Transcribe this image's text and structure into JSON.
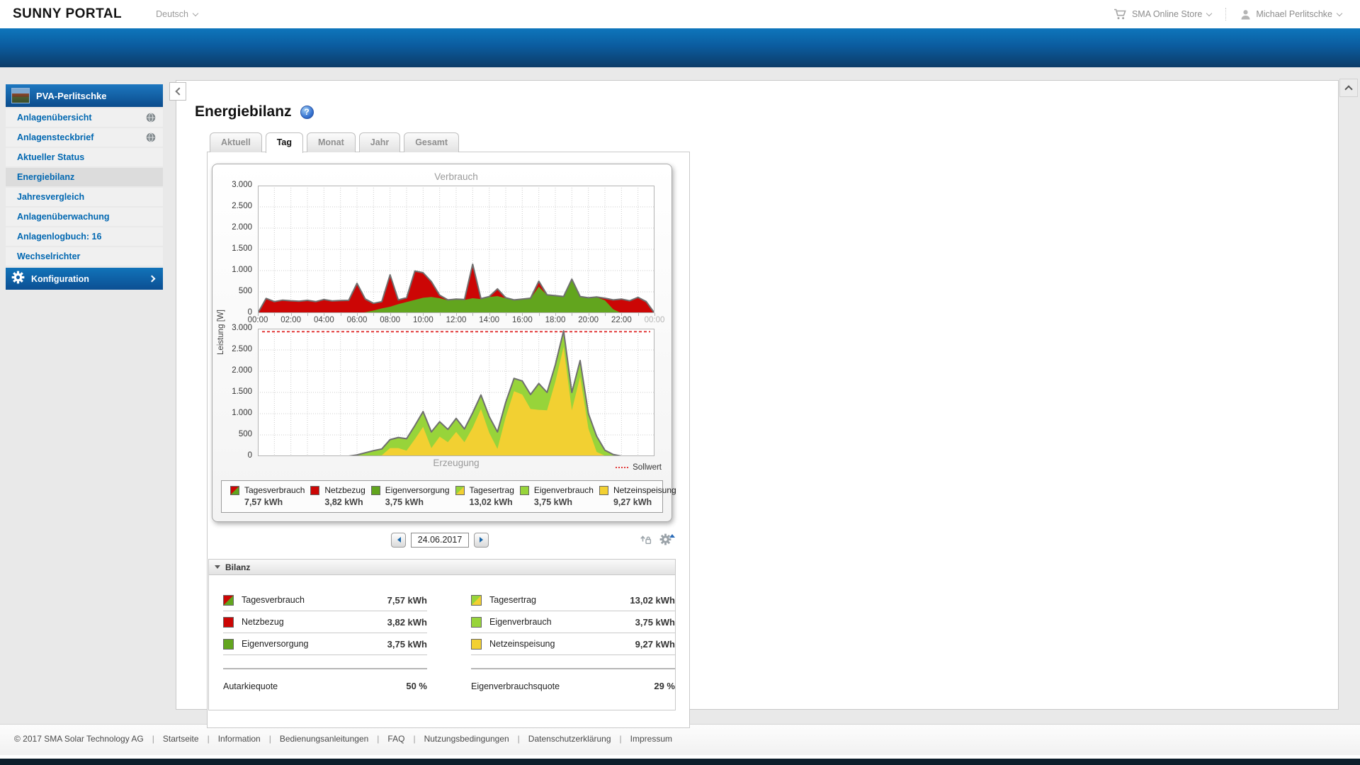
{
  "header": {
    "logo": "SUNNY PORTAL",
    "language": "Deutsch",
    "store": "SMA Online Store",
    "user": "Michael Perlitschke"
  },
  "sidebar": {
    "plant_name": "PVA-Perlitschke",
    "items": [
      {
        "id": "anlagenuebersicht",
        "label": "Anlagenübersicht",
        "globe": true,
        "active": false
      },
      {
        "id": "anlagensteckbrief",
        "label": "Anlagensteckbrief",
        "globe": true,
        "active": false
      },
      {
        "id": "aktueller-status",
        "label": "Aktueller Status",
        "globe": false,
        "active": false
      },
      {
        "id": "energiebilanz",
        "label": "Energiebilanz",
        "globe": false,
        "active": true
      },
      {
        "id": "jahresvergleich",
        "label": "Jahresvergleich",
        "globe": false,
        "active": false
      },
      {
        "id": "anlagenueberwachung",
        "label": "Anlagenüberwachung",
        "globe": false,
        "active": false
      },
      {
        "id": "anlagenlogbuch",
        "label": "Anlagenlogbuch: 16",
        "globe": false,
        "active": false
      },
      {
        "id": "wechselrichter",
        "label": "Wechselrichter",
        "globe": false,
        "active": false
      }
    ],
    "config_label": "Konfiguration"
  },
  "page": {
    "title": "Energiebilanz",
    "help_icon_char": "?"
  },
  "tabs": [
    {
      "id": "aktuell",
      "label": "Aktuell",
      "active": false
    },
    {
      "id": "tag",
      "label": "Tag",
      "active": true
    },
    {
      "id": "monat",
      "label": "Monat",
      "active": false
    },
    {
      "id": "jahr",
      "label": "Jahr",
      "active": false
    },
    {
      "id": "gesamt",
      "label": "Gesamt",
      "active": false
    }
  ],
  "datenav": {
    "date": "24.06.2017"
  },
  "colors": {
    "accent_blue": "#0067b1",
    "netzbezug_red": "#cc0605",
    "eigenversorgung_green": "#62a51e",
    "eigenverbrauch_lightgreen": "#97d43a",
    "netzeinspeisung_yellow": "#f2d032",
    "outline_gray": "#6f6f6f",
    "sollwert_red": "#e23b3b"
  },
  "legend": [
    {
      "name": "Tagesverbrauch",
      "value": "7,57 kWh",
      "swatch": [
        "#cc0605",
        "#62a51e"
      ]
    },
    {
      "name": "Netzbezug",
      "value": "3,82 kWh",
      "swatch": [
        "#cc0605"
      ]
    },
    {
      "name": "Eigenversorgung",
      "value": "3,75 kWh",
      "swatch": [
        "#62a51e"
      ]
    },
    {
      "name": "Tagesertrag",
      "value": "13,02 kWh",
      "swatch": [
        "#97d43a",
        "#f2d032"
      ]
    },
    {
      "name": "Eigenverbrauch",
      "value": "3,75 kWh",
      "swatch": [
        "#97d43a"
      ]
    },
    {
      "name": "Netzeinspeisung",
      "value": "9,27 kWh",
      "swatch": [
        "#f2d032"
      ]
    }
  ],
  "bilanz": {
    "title": "Bilanz",
    "left": {
      "rows": [
        {
          "label": "Tagesverbrauch",
          "value": "7,57 kWh",
          "swatch": [
            "#cc0605",
            "#62a51e"
          ]
        },
        {
          "label": "Netzbezug",
          "value": "3,82 kWh",
          "swatch": [
            "#cc0605"
          ]
        },
        {
          "label": "Eigenversorgung",
          "value": "3,75 kWh",
          "swatch": [
            "#62a51e"
          ]
        }
      ],
      "quote": {
        "label": "Autarkiequote",
        "value": "50 %"
      }
    },
    "right": {
      "rows": [
        {
          "label": "Tagesertrag",
          "value": "13,02 kWh",
          "swatch": [
            "#97d43a",
            "#f2d032"
          ]
        },
        {
          "label": "Eigenverbrauch",
          "value": "3,75 kWh",
          "swatch": [
            "#97d43a"
          ]
        },
        {
          "label": "Netzeinspeisung",
          "value": "9,27 kWh",
          "swatch": [
            "#f2d032"
          ]
        }
      ],
      "quote": {
        "label": "Eigenverbrauchsquote",
        "value": "29 %"
      }
    }
  },
  "footer": {
    "divider": "|",
    "links": [
      "© 2017 SMA Solar Technology AG",
      "Startseite",
      "Information",
      "Bedienungsanleitungen",
      "FAQ",
      "Nutzungsbedingungen",
      "Datenschutzerklärung",
      "Impressum"
    ]
  },
  "chart_data": [
    {
      "type": "area",
      "title": "Verbrauch",
      "ylabel": "Leistung [W]",
      "ylim": [
        0,
        3000
      ],
      "y_ticks": [
        "3.000",
        "2.500",
        "2.000",
        "1.500",
        "1.000",
        "500",
        "0"
      ],
      "x_ticks": [
        "00:00",
        "02:00",
        "04:00",
        "06:00",
        "08:00",
        "10:00",
        "12:00",
        "14:00",
        "16:00",
        "18:00",
        "20:00",
        "22:00",
        "00:00"
      ],
      "interval_minutes": 30,
      "outline_color": "#6f6f6f",
      "total_name": "Tagesverbrauch",
      "total_kwh": "7,57 kWh",
      "total_values": [
        0,
        345,
        270,
        305,
        290,
        280,
        300,
        270,
        320,
        285,
        295,
        300,
        700,
        330,
        230,
        270,
        900,
        310,
        360,
        990,
        950,
        740,
        420,
        310,
        330,
        320,
        1150,
        340,
        390,
        570,
        360,
        310,
        330,
        350,
        750,
        430,
        410,
        390,
        800,
        390,
        360,
        380,
        350,
        310,
        330,
        290,
        370,
        270,
        0
      ],
      "upper_name": "Netzbezug",
      "upper_color": "#cc0605",
      "upper_kwh": "3,82 kWh",
      "upper_values": [
        0,
        345,
        270,
        305,
        290,
        280,
        300,
        270,
        320,
        285,
        295,
        300,
        700,
        310,
        170,
        160,
        750,
        100,
        100,
        680,
        590,
        360,
        70,
        10,
        10,
        10,
        800,
        10,
        10,
        170,
        10,
        10,
        10,
        10,
        130,
        10,
        10,
        10,
        10,
        10,
        10,
        10,
        50,
        220,
        330,
        290,
        370,
        270,
        0
      ],
      "lower_name": "Eigenversorgung",
      "lower_color": "#62a51e",
      "lower_kwh": "3,75 kWh",
      "lower_values": [
        0,
        0,
        0,
        0,
        0,
        0,
        0,
        0,
        0,
        0,
        0,
        0,
        0,
        20,
        60,
        110,
        150,
        210,
        260,
        310,
        360,
        380,
        350,
        300,
        320,
        310,
        350,
        330,
        380,
        400,
        350,
        300,
        320,
        340,
        620,
        420,
        400,
        380,
        790,
        380,
        350,
        370,
        300,
        90,
        0,
        0,
        0,
        0,
        0
      ]
    },
    {
      "type": "area",
      "title": "Erzeugung",
      "ylabel": "Leistung [W]",
      "ylim": [
        0,
        3000
      ],
      "y_ticks": [
        "3.000",
        "2.500",
        "2.000",
        "1.500",
        "1.000",
        "500",
        "0"
      ],
      "x_ticks": [
        "00:00",
        "02:00",
        "04:00",
        "06:00",
        "08:00",
        "10:00",
        "12:00",
        "14:00",
        "16:00",
        "18:00",
        "20:00",
        "22:00",
        "00:00"
      ],
      "interval_minutes": 30,
      "outline_color": "#6f6f6f",
      "sollwert": 2930,
      "sollwert_label": "Sollwert",
      "sollwert_color": "#e23b3b",
      "total_name": "Tagesertrag",
      "total_kwh": "13,02 kWh",
      "total_values": [
        0,
        0,
        0,
        0,
        0,
        0,
        0,
        0,
        0,
        0,
        0,
        0,
        30,
        80,
        130,
        170,
        390,
        440,
        410,
        720,
        1050,
        570,
        810,
        630,
        890,
        640,
        1020,
        1440,
        930,
        570,
        1270,
        1830,
        1770,
        1450,
        1710,
        1500,
        2150,
        2950,
        1500,
        2250,
        1000,
        470,
        140,
        40,
        0,
        0,
        0,
        0,
        0
      ],
      "upper_name": "Eigenverbrauch",
      "upper_color": "#97d43a",
      "upper_kwh": "3,75 kWh",
      "upper_values": [
        0,
        0,
        0,
        0,
        0,
        0,
        0,
        0,
        0,
        0,
        0,
        0,
        25,
        70,
        115,
        150,
        200,
        250,
        280,
        320,
        360,
        380,
        350,
        300,
        320,
        310,
        350,
        330,
        380,
        400,
        350,
        300,
        320,
        340,
        620,
        420,
        400,
        380,
        420,
        380,
        350,
        370,
        130,
        35,
        0,
        0,
        0,
        0,
        0
      ],
      "lower_name": "Netzeinspeisung",
      "lower_color": "#f2d032",
      "lower_kwh": "9,27 kWh",
      "lower_values": [
        0,
        0,
        0,
        0,
        0,
        0,
        0,
        0,
        0,
        0,
        0,
        0,
        5,
        10,
        15,
        20,
        190,
        190,
        130,
        400,
        690,
        190,
        460,
        330,
        570,
        330,
        670,
        1110,
        550,
        170,
        920,
        1530,
        1450,
        1110,
        1090,
        1080,
        1750,
        2570,
        1080,
        1870,
        650,
        100,
        10,
        5,
        0,
        0,
        0,
        0,
        0
      ]
    }
  ]
}
